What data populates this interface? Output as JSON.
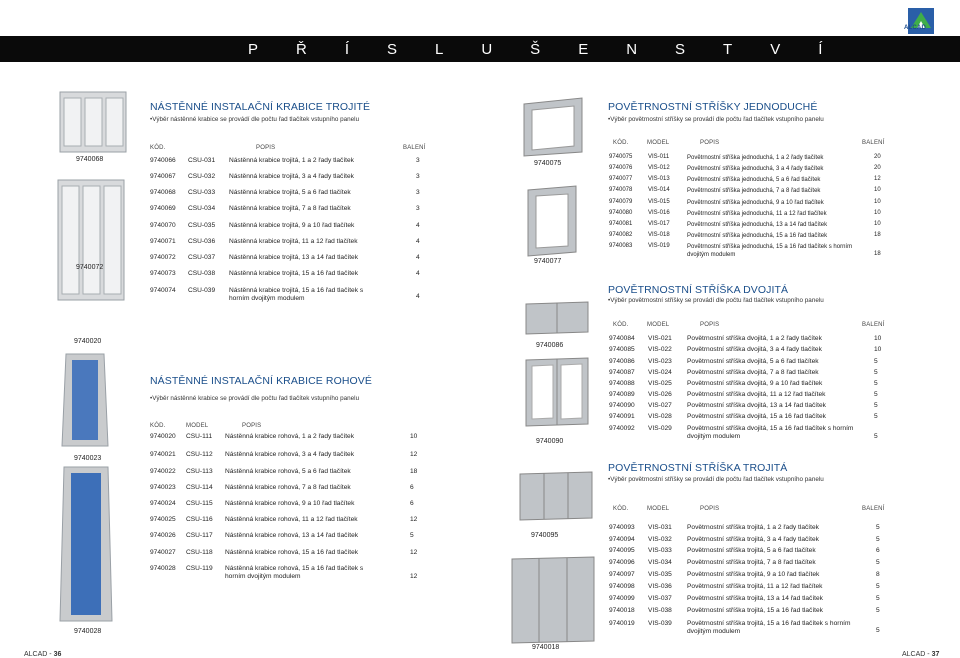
{
  "brand": {
    "logo_text": "ALCAD"
  },
  "banner": {
    "title": "PŘÍSLUŠENSTVÍ"
  },
  "left": {
    "trojite": {
      "title": "NÁSTĚNNÉ INSTALAČNÍ KRABICE TROJITÉ",
      "subtitle": "•Výběr nástěnné krabice se provádí dle počtu řad tlačítek vstupního panelu",
      "headers": {
        "kod": "KÓD.",
        "popis": "POPIS",
        "baleni": "BALENÍ"
      },
      "rows": [
        {
          "kod": "9740066",
          "model": "CSU-031",
          "popis": "Nástěnná krabice trojitá, 1 a 2 řady tlačítek",
          "baleni": "3"
        },
        {
          "kod": "9740067",
          "model": "CSU-032",
          "popis": "Nástěnná krabice trojitá, 3 a 4 řady tlačítek",
          "baleni": "3"
        },
        {
          "kod": "9740068",
          "model": "CSU-033",
          "popis": "Nástěnná krabice trojitá, 5 a 6 řad tlačítek",
          "baleni": "3"
        },
        {
          "kod": "9740069",
          "model": "CSU-034",
          "popis": "Nástěnná krabice trojitá, 7 a 8 řad tlačítek",
          "baleni": "3"
        },
        {
          "kod": "9740070",
          "model": "CSU-035",
          "popis": "Nástěnná krabice trojitá, 9 a 10 řad tlačítek",
          "baleni": "4"
        },
        {
          "kod": "9740071",
          "model": "CSU-036",
          "popis": "Nástěnná krabice trojitá, 11 a 12 řad tlačítek",
          "baleni": "4"
        },
        {
          "kod": "9740072",
          "model": "CSU-037",
          "popis": "Nástěnná krabice trojitá, 13 a 14 řad tlačítek",
          "baleni": "4"
        },
        {
          "kod": "9740073",
          "model": "CSU-038",
          "popis": "Nástěnná krabice trojitá, 15 a 16 řad tlačítek",
          "baleni": "4"
        },
        {
          "kod": "9740074",
          "model": "CSU-039",
          "popis": "Nástěnná krabice trojitá, 15 a 16 řad tlačítek s horním dvojitým modulem",
          "baleni": "4"
        }
      ],
      "img_labels": [
        "9740068",
        "9740072"
      ]
    },
    "rohove": {
      "title": "NÁSTĚNNÉ INSTALAČNÍ KRABICE ROHOVÉ",
      "subtitle": "•Výběr nástěnné krabice se provádí dle počtu řad tlačítek vstupního panelu",
      "headers": {
        "kod": "KÓD.",
        "model": "MODEL",
        "popis": "POPIS"
      },
      "rows": [
        {
          "kod": "9740020",
          "model": "CSU-111",
          "popis": "Nástěnná krabice rohová, 1 a 2 řady tlačítek",
          "baleni": "10"
        },
        {
          "kod": "9740021",
          "model": "CSU-112",
          "popis": "Nástěnná krabice rohová, 3 a 4 řady tlačítek",
          "baleni": "12"
        },
        {
          "kod": "9740022",
          "model": "CSU-113",
          "popis": "Nástěnná krabice rohová, 5 a 6 řad tlačítek",
          "baleni": "18"
        },
        {
          "kod": "9740023",
          "model": "CSU-114",
          "popis": "Nástěnná krabice rohová, 7 a 8 řad tlačítek",
          "baleni": "6"
        },
        {
          "kod": "9740024",
          "model": "CSU-115",
          "popis": "Nástěnná krabice rohová, 9 a 10 řad tlačítek",
          "baleni": "6"
        },
        {
          "kod": "9740025",
          "model": "CSU-116",
          "popis": "Nástěnná krabice rohová, 11 a 12 řad tlačítek",
          "baleni": "12"
        },
        {
          "kod": "9740026",
          "model": "CSU-117",
          "popis": "Nástěnná krabice rohová, 13 a 14 řad tlačítek",
          "baleni": "5"
        },
        {
          "kod": "9740027",
          "model": "CSU-118",
          "popis": "Nástěnná krabice rohová, 15 a 16 řad tlačítek",
          "baleni": "12"
        },
        {
          "kod": "9740028",
          "model": "CSU-119",
          "popis": "Nástěnná krabice rohová, 15 a 16 řad tlačítek s horním dvojitým modulem",
          "baleni": "12"
        }
      ],
      "img_labels": [
        "9740020",
        "9740023",
        "9740028"
      ]
    },
    "footer": {
      "brand": "ALCAD - ",
      "page": "36"
    }
  },
  "middle": {
    "img_labels": [
      "9740075",
      "9740077",
      "9740086",
      "9740090",
      "9740095",
      "9740018"
    ]
  },
  "right": {
    "jednoduche": {
      "title": "POVĚTRNOSTNÍ STŘÍŠKY JEDNODUCHÉ",
      "subtitle": "•Výběr povětrnostní stříšky se provádí dle počtu řad tlačítek vstupního panelu",
      "headers": {
        "kod": "KÓD.",
        "model": "MODEL",
        "popis": "POPIS",
        "baleni": "BALENÍ"
      },
      "rows": [
        {
          "kod": "9740075",
          "model": "VIS-011",
          "popis": "Povětrnostní stříška jednoduchá, 1 a 2 řady tlačítek",
          "baleni": "20"
        },
        {
          "kod": "9740076",
          "model": "VIS-012",
          "popis": "Povětrnostní stříška jednoduchá, 3 a 4 řady tlačítek",
          "baleni": "20"
        },
        {
          "kod": "9740077",
          "model": "VIS-013",
          "popis": "Povětrnostní stříška jednoduchá, 5 a 6 řad tlačítek",
          "baleni": "12"
        },
        {
          "kod": "9740078",
          "model": "VIS-014",
          "popis": "Povětrnostní stříška jednoduchá, 7 a 8 řad tlačítek",
          "baleni": "10"
        },
        {
          "kod": "9740079",
          "model": "VIS-015",
          "popis": "Povětrnostní stříška jednoduchá, 9 a 10 řad tlačítek",
          "baleni": "10"
        },
        {
          "kod": "9740080",
          "model": "VIS-016",
          "popis": "Povětrnostní stříška jednoduchá, 11 a 12 řad tlačítek",
          "baleni": "10"
        },
        {
          "kod": "9740081",
          "model": "VIS-017",
          "popis": "Povětrnostní stříška jednoduchá, 13 a 14 řad tlačítek",
          "baleni": "10"
        },
        {
          "kod": "9740082",
          "model": "VIS-018",
          "popis": "Povětrnostní stříška jednoduchá, 15 a 16 řad tlačítek",
          "baleni": "18"
        },
        {
          "kod": "9740083",
          "model": "VIS-019",
          "popis": "Povětrnostní stříška jednoduchá, 15 a 16 řad tlačítek s horním dvojitým modulem",
          "baleni": "18"
        }
      ]
    },
    "dvojita": {
      "title": "POVĚTRNOSTNÍ STŘÍŠKA DVOJITÁ",
      "subtitle": "•Výběr povětrnostní stříšky se provádí dle počtu řad tlačítek vstupního panelu",
      "headers": {
        "kod": "KÓD.",
        "model": "MODEL",
        "popis": "POPIS",
        "baleni": "BALENÍ"
      },
      "rows": [
        {
          "kod": "9740084",
          "model": "VIS-021",
          "popis": "Povětrnostní stříška dvojitá, 1 a 2 řady tlačítek",
          "baleni": "10"
        },
        {
          "kod": "9740085",
          "model": "VIS-022",
          "popis": "Povětrnostní stříška dvojitá, 3 a 4 řady tlačítek",
          "baleni": "10"
        },
        {
          "kod": "9740086",
          "model": "VIS-023",
          "popis": "Povětrnostní stříška dvojitá, 5 a 6 řad tlačítek",
          "baleni": "5"
        },
        {
          "kod": "9740087",
          "model": "VIS-024",
          "popis": "Povětrnostní stříška dvojitá, 7 a 8 řad tlačítek",
          "baleni": "5"
        },
        {
          "kod": "9740088",
          "model": "VIS-025",
          "popis": "Povětrnostní stříška dvojitá, 9 a 10 řad tlačítek",
          "baleni": "5"
        },
        {
          "kod": "9740089",
          "model": "VIS-026",
          "popis": "Povětrnostní stříška dvojitá, 11 a 12 řad tlačítek",
          "baleni": "5"
        },
        {
          "kod": "9740090",
          "model": "VIS-027",
          "popis": "Povětrnostní stříška dvojitá, 13 a 14 řad tlačítek",
          "baleni": "5"
        },
        {
          "kod": "9740091",
          "model": "VIS-028",
          "popis": "Povětrnostní stříška dvojitá, 15 a 16 řad tlačítek",
          "baleni": "5"
        },
        {
          "kod": "9740092",
          "model": "VIS-029",
          "popis": "Povětrnostní stříška dvojitá, 15 a 16 řad tlačítek s horním dvojitým modulem",
          "baleni": "5"
        }
      ]
    },
    "trojita": {
      "title": "POVĚTRNOSTNÍ STŘÍŠKA TROJITÁ",
      "subtitle": "•Výběr povětrnostní stříšky se provádí dle počtu řad tlačítek vstupního panelu",
      "headers": {
        "kod": "KÓD.",
        "model": "MODEL",
        "popis": "POPIS",
        "baleni": "BALENÍ"
      },
      "rows": [
        {
          "kod": "9740093",
          "model": "VIS-031",
          "popis": "Povětrnostní stříška trojitá, 1 a 2 řady tlačítek",
          "baleni": "5"
        },
        {
          "kod": "9740094",
          "model": "VIS-032",
          "popis": "Povětrnostní stříška trojitá, 3 a 4 řady tlačítek",
          "baleni": "5"
        },
        {
          "kod": "9740095",
          "model": "VIS-033",
          "popis": "Povětrnostní stříška trojitá, 5 a 6 řad tlačítek",
          "baleni": "6"
        },
        {
          "kod": "9740096",
          "model": "VIS-034",
          "popis": "Povětrnostní stříška trojitá, 7 a 8 řad tlačítek",
          "baleni": "5"
        },
        {
          "kod": "9740097",
          "model": "VIS-035",
          "popis": "Povětrnostní stříška trojitá, 9 a 10 řad tlačítek",
          "baleni": "8"
        },
        {
          "kod": "9740098",
          "model": "VIS-036",
          "popis": "Povětrnostní stříška trojitá, 11 a 12 řad tlačítek",
          "baleni": "5"
        },
        {
          "kod": "9740099",
          "model": "VIS-037",
          "popis": "Povětrnostní stříška trojitá, 13 a 14 řad tlačítek",
          "baleni": "5"
        },
        {
          "kod": "9740018",
          "model": "VIS-038",
          "popis": "Povětrnostní stříška trojitá, 15 a 16 řad tlačítek",
          "baleni": "5"
        },
        {
          "kod": "9740019",
          "model": "VIS-039",
          "popis": "Povětrnostní stříška trojitá, 15 a 16 řad tlačítek s horním dvojitým modulem",
          "baleni": "5"
        }
      ]
    },
    "footer": {
      "brand": "ALCAD - ",
      "page": "37"
    }
  },
  "colors": {
    "accent": "#1a4e8a",
    "banner": "#0a0a0a",
    "box_blue": "#3d6fb8"
  }
}
